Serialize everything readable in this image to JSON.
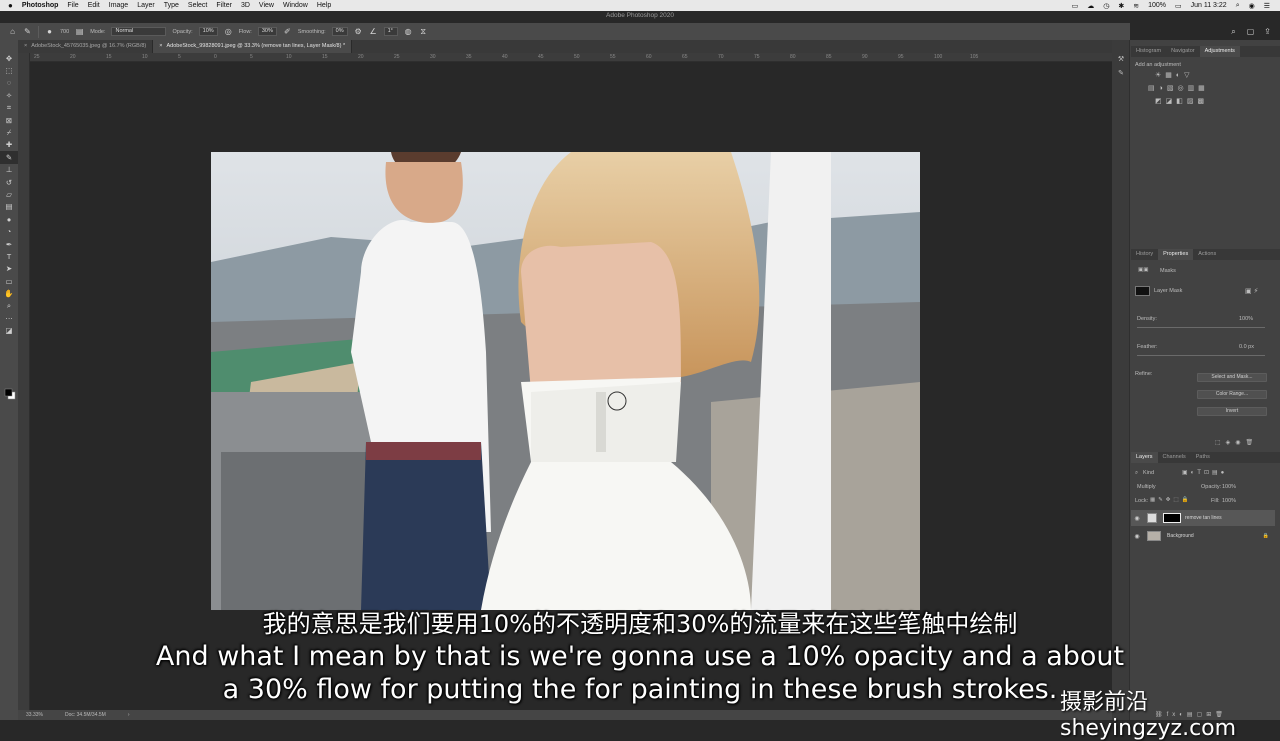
{
  "menubar": {
    "app_name": "Photoshop",
    "items": [
      "File",
      "Edit",
      "Image",
      "Layer",
      "Type",
      "Select",
      "Filter",
      "3D",
      "View",
      "Window",
      "Help"
    ],
    "battery": "100%",
    "datetime": "Jun 11  3:22"
  },
  "window_title": "Adobe Photoshop 2020",
  "options": {
    "brush_size": "700",
    "mode_label": "Mode:",
    "mode_value": "Normal",
    "opacity_label": "Opacity:",
    "opacity_value": "10%",
    "flow_label": "Flow:",
    "flow_value": "30%",
    "smoothing_label": "Smoothing:",
    "smoothing_value": "0%",
    "angle_value": "1°"
  },
  "tabs": [
    {
      "label": "AdobeStock_45765035.jpeg @ 16.7% (RGB/8)"
    },
    {
      "label": "AdobeStock_99828091.jpeg @ 33.3% (remove tan lines, Layer Mask/8) *"
    }
  ],
  "ruler_h": [
    "25",
    "20",
    "15",
    "10",
    "5",
    "0",
    "5",
    "10",
    "15",
    "20",
    "25",
    "30",
    "35",
    "40",
    "45",
    "50",
    "55",
    "60",
    "65",
    "70",
    "75",
    "80",
    "85",
    "90",
    "95",
    "100",
    "105"
  ],
  "status": {
    "zoom": "33.33%",
    "doc": "Doc: 34.5M/34.5M"
  },
  "panels": {
    "top_tabs": [
      "Histogram",
      "Navigator",
      "Adjustments"
    ],
    "add_adjustment": "Add an adjustment",
    "mid_tabs": [
      "History",
      "Properties",
      "Actions"
    ],
    "masks_label": "Masks",
    "layer_mask_label": "Layer Mask",
    "density_label": "Density:",
    "density_value": "100%",
    "feather_label": "Feather:",
    "feather_value": "0.0 px",
    "refine_label": "Refine:",
    "btn_select_mask": "Select and Mask...",
    "btn_color_range": "Color Range...",
    "btn_invert": "Invert",
    "layer_tabs": [
      "Layers",
      "Channels",
      "Paths"
    ],
    "kind_label": "Kind",
    "blend_mode": "Multiply",
    "opacity_label": "Opacity:",
    "opacity_value": "100%",
    "lock_label": "Lock:",
    "fill_label": "Fill:",
    "fill_value": "100%",
    "layers": [
      {
        "name": "remove tan lines"
      },
      {
        "name": "Background"
      }
    ]
  },
  "subtitles": {
    "cn": "我的意思是我们要用10%的不透明度和30%的流量来在这些笔触中绘制",
    "en_line1": "And what I mean by that is we're gonna use a 10% opacity and a about",
    "en_line2": "a 30% flow for putting the for painting in these brush strokes."
  },
  "watermark": "摄影前沿 sheyingzyz.com"
}
